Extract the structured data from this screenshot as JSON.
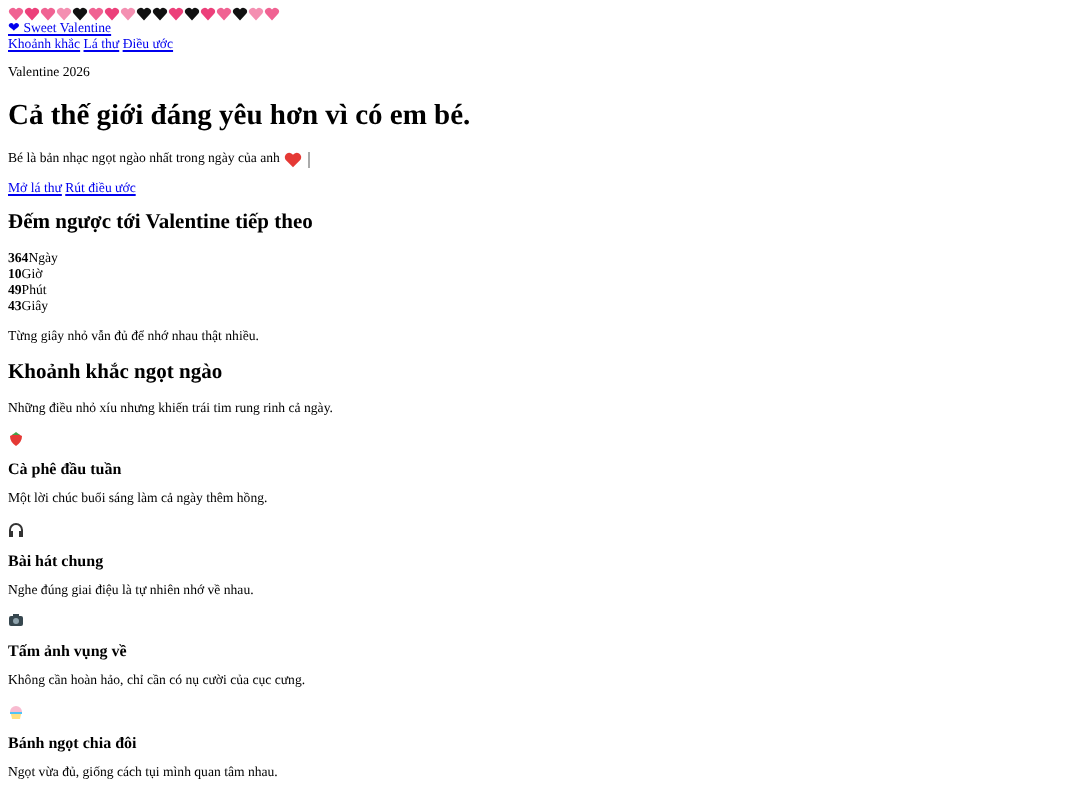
{
  "brand": "❤ Sweet Valentine",
  "nav": [
    "Khoảnh khắc",
    "Lá thư",
    "Điều ước"
  ],
  "eyebrow": "Valentine 2026",
  "title": "Cả thế giới đáng yêu hơn vì có em bé.",
  "subtitle": "Bé là bản nhạc ngọt ngào nhất trong ngày của anh",
  "actions": [
    "Mở lá thư",
    "Rút điều ước"
  ],
  "countdown": {
    "heading": "Đếm ngược tới Valentine tiếp theo",
    "units": [
      "**364**Ngày",
      "**10**Giờ",
      "**49**Phút",
      "**43**Giây"
    ],
    "note": "Từng giây nhỏ vẫn đủ để nhớ nhau thật nhiều."
  },
  "moments": {
    "heading": "Khoảnh khắc ngọt ngào",
    "intro": "Những điều nhỏ xíu nhưng khiến trái tim rung rinh cả ngày.",
    "items": [
      {
        "title": "Cà phê đầu tuần",
        "text": "Một lời chúc buổi sáng làm cả ngày thêm hồng."
      },
      {
        "title": "Bài hát chung",
        "text": "Nghe đúng giai điệu là tự nhiên nhớ về nhau."
      },
      {
        "title": "Tấm ảnh vụng về",
        "text": "Không cần hoàn hảo, chỉ cần có nụ cười của cục cưng."
      },
      {
        "title": "Bánh ngọt chia đôi",
        "text": "Ngọt vừa đủ, giống cách tụi mình quan tâm nhau."
      }
    ]
  }
}
